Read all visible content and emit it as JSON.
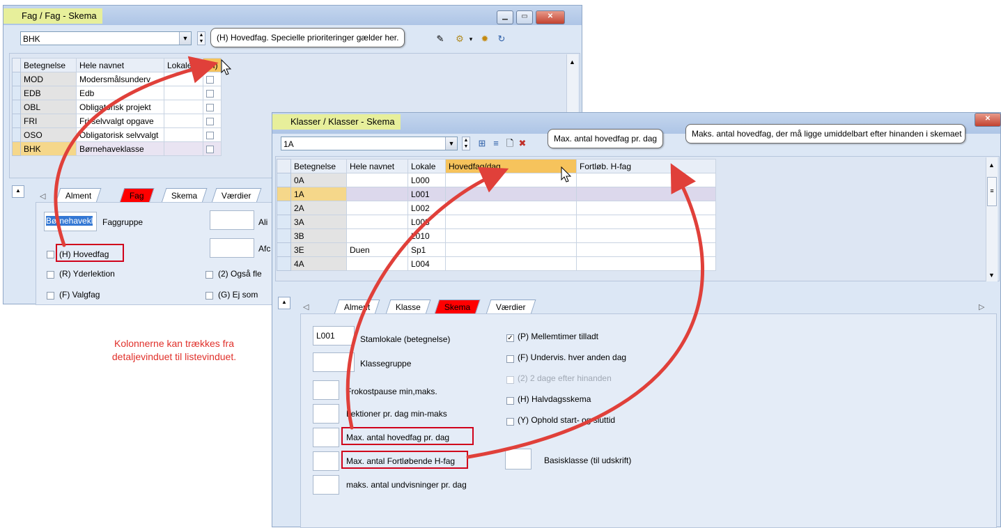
{
  "fag_window": {
    "title": "Fag / Fag - Skema",
    "combo_value": "BHK",
    "tooltip": "(H) Hovedfag. Specielle prioriteringer gælder her.",
    "columns": [
      "Betegnelse",
      "Hele navnet",
      "Lokale",
      "(H)"
    ],
    "rows": [
      {
        "code": "MOD",
        "name": "Modersmålsunderv"
      },
      {
        "code": "EDB",
        "name": "Edb"
      },
      {
        "code": "OBL",
        "name": "Obligatorisk projekt"
      },
      {
        "code": "FRI",
        "name": "Fri selvvalgt opgave"
      },
      {
        "code": "OSO",
        "name": "Obligatorisk selvvalgt"
      },
      {
        "code": "BHK",
        "name": "Børnehaveklasse"
      }
    ],
    "tabs": [
      "Alment",
      "Fag",
      "Skema",
      "Værdier"
    ],
    "detail": {
      "field_value": "Børnehavekl",
      "faggruppe_label": "Faggruppe",
      "right_label_1": "Ali",
      "right_label_2": "Afc",
      "hovedfag_label": "(H) Hovedfag",
      "yderlektion_label": "(R) Yderlektion",
      "valgfag_label": "(F) Valgfag",
      "ogsaa_label": "(2) Også fle",
      "ej_som_label": "(G) Ej som"
    }
  },
  "annotation": {
    "line1": "Kolonnerne kan trækkes fra",
    "line2": "detaljevinduet til listevinduet."
  },
  "klasser_window": {
    "title": "Klasser / Klasser - Skema",
    "combo_value": "1A",
    "tooltip_1": "Max. antal hovedfag pr. dag",
    "tooltip_2": "Maks. antal hovedfag, der må ligge umiddelbart efter hinanden i skemaet",
    "columns": [
      "Betegnelse",
      "Hele navnet",
      "Lokale",
      "Hovedfag/dag",
      "Fortløb. H-fag"
    ],
    "rows": [
      {
        "code": "0A",
        "name": "",
        "room": "L000"
      },
      {
        "code": "1A",
        "name": "",
        "room": "L001"
      },
      {
        "code": "2A",
        "name": "",
        "room": "L002"
      },
      {
        "code": "3A",
        "name": "",
        "room": "L003"
      },
      {
        "code": "3B",
        "name": "",
        "room": "L010"
      },
      {
        "code": "3E",
        "name": "Duen",
        "room": "Sp1"
      },
      {
        "code": "4A",
        "name": "",
        "room": "L004"
      }
    ],
    "tabs": [
      "Alment",
      "Klasse",
      "Skema",
      "Værdier"
    ],
    "detail": {
      "stamlokale_value": "L001",
      "stamlokale_label": "Stamlokale (betegnelse)",
      "klassegruppe_label": "Klassegruppe",
      "frokost_label": "Frokostpause min,maks.",
      "lektioner_label": "Lektioner pr. dag min-maks",
      "max_hovedfag_label": "Max. antal hovedfag pr. dag",
      "max_fortlob_label": "Max. antal Fortløbende H-fag",
      "maks_undv_label": "maks. antal undvisninger pr. dag",
      "mellemtimer_label": "(P) Mellemtimer tilladt",
      "undervis_label": "(F) Undervis. hver anden dag",
      "to_dage_label": "(2) 2 dage efter hinanden",
      "halvdag_label": "(H) Halvdagsskema",
      "ophold_label": "(Y) Ophold start- og sluttid",
      "basisklasse_label": "Basisklasse (til udskrift)"
    }
  },
  "colors": {
    "arrow": "#e0403a",
    "highlight_box": "#d0021b",
    "active_tab": "#ff0000",
    "selected_row": "#f5d78a",
    "header_highlight": "#f6c35c",
    "window_bg": "#dce7f5",
    "annotation_text": "#e0302a"
  }
}
